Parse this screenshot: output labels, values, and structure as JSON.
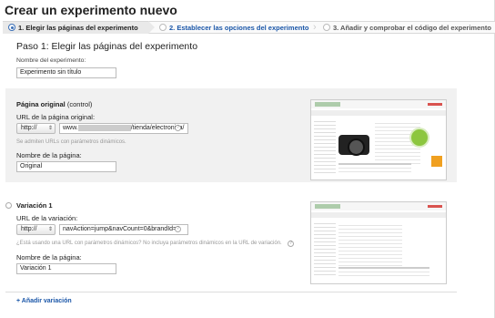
{
  "page_title": "Crear un experimento nuevo",
  "steps": [
    {
      "label": "1. Elegir las páginas del experimento"
    },
    {
      "label": "2. Establecer las opciones del experimento"
    },
    {
      "label": "3. Añadir y comprobar el código del experimento"
    }
  ],
  "section_title": "Paso 1: Elegir las páginas del experimento",
  "experiment_name": {
    "label": "Nombre del experimento:",
    "value": "Experimento sin título"
  },
  "original": {
    "title": "Página original",
    "title_suffix": "(control)",
    "url_label": "URL de la página original:",
    "protocol": "http://",
    "url_prefix": "www.",
    "url_suffix": "/tienda/electronica/",
    "hint": "Se admiten URLs con parámetros dinámicos.",
    "name_label": "Nombre de la página:",
    "name_value": "Original"
  },
  "variation": {
    "title": "Variación 1",
    "url_label": "URL de la variación:",
    "protocol": "http://",
    "url_value": "navAction=jump&navCount=0&brandId=",
    "hint": "¿Está usando una URL con parámetros dinámicos? No incluya parámetros dinámicos en la URL de variación.",
    "name_label": "Nombre de la página:",
    "name_value": "Variación 1"
  },
  "add_variation": "+ Añadir variación",
  "colors": {
    "link_blue": "#1a56a8",
    "panel_gray": "#f1f1f1"
  },
  "icons": {
    "help": "?",
    "select_arrows": "⇕"
  }
}
